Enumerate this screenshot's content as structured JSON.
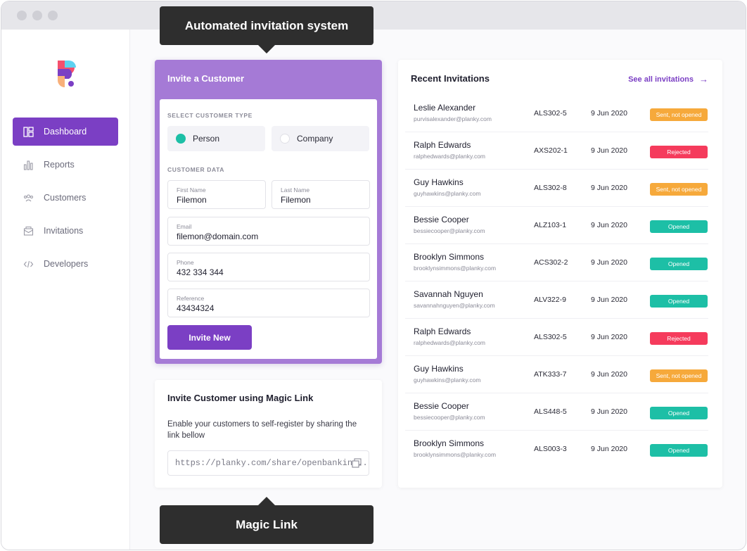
{
  "colors": {
    "accent": "#7b3fc4",
    "teal": "#1dbfa6",
    "orange": "#f6a93b",
    "red": "#f53b5c"
  },
  "sidebar": {
    "items": [
      {
        "label": "Dashboard",
        "icon": "dashboard-icon",
        "active": true
      },
      {
        "label": "Reports",
        "icon": "bar-chart-icon",
        "active": false
      },
      {
        "label": "Customers",
        "icon": "users-icon",
        "active": false
      },
      {
        "label": "Invitations",
        "icon": "envelope-icon",
        "active": false
      },
      {
        "label": "Developers",
        "icon": "code-icon",
        "active": false
      }
    ]
  },
  "callouts": {
    "top": "Automated invitation system",
    "bottom": "Magic Link"
  },
  "invite": {
    "title": "Invite a Customer",
    "type_label": "SELECT CUSTOMER TYPE",
    "type_person": "Person",
    "type_company": "Company",
    "selected_type": "Person",
    "data_label": "CUSTOMER DATA",
    "first_name_label": "First Name",
    "first_name_value": "Filemon",
    "last_name_label": "Last Name",
    "last_name_value": "Filemon",
    "email_label": "Email",
    "email_value": "filemon@domain.com",
    "phone_label": "Phone",
    "phone_value": "432 334 344",
    "reference_label": "Reference",
    "reference_value": "43434324",
    "button": "Invite New"
  },
  "magic": {
    "title": "Invite Customer using Magic Link",
    "description": "Enable your customers to self-register by sharing the link bellow",
    "link": "https://planky.com/share/openbankin..."
  },
  "recent": {
    "title": "Recent Invitations",
    "see_all": "See all invitations",
    "rows": [
      {
        "name": "Leslie Alexander",
        "email": "purvisalexander@planky.com",
        "code": "ALS302-5",
        "date": "9 Jun 2020",
        "status": "Sent, not opened",
        "color": "#f6a93b"
      },
      {
        "name": "Ralph Edwards",
        "email": "ralphedwards@planky.com",
        "code": "AXS202-1",
        "date": "9 Jun 2020",
        "status": "Rejected",
        "color": "#f53b5c"
      },
      {
        "name": "Guy Hawkins",
        "email": "guyhawkins@planky.com",
        "code": "ALS302-8",
        "date": "9 Jun 2020",
        "status": "Sent, not opened",
        "color": "#f6a93b"
      },
      {
        "name": "Bessie Cooper",
        "email": "bessiecooper@planky.com",
        "code": "ALZ103-1",
        "date": "9 Jun 2020",
        "status": "Opened",
        "color": "#1dbfa6"
      },
      {
        "name": "Brooklyn Simmons",
        "email": "brooklynsimmons@planky.com",
        "code": "ACS302-2",
        "date": "9 Jun 2020",
        "status": "Opened",
        "color": "#1dbfa6"
      },
      {
        "name": "Savannah Nguyen",
        "email": "savannahnguyen@planky.com",
        "code": "ALV322-9",
        "date": "9 Jun 2020",
        "status": "Opened",
        "color": "#1dbfa6"
      },
      {
        "name": "Ralph Edwards",
        "email": "ralphedwards@planky.com",
        "code": "ALS302-5",
        "date": "9 Jun 2020",
        "status": "Rejected",
        "color": "#f53b5c"
      },
      {
        "name": "Guy Hawkins",
        "email": "guyhawkins@planky.com",
        "code": "ATK333-7",
        "date": "9 Jun 2020",
        "status": "Sent, not opened",
        "color": "#f6a93b"
      },
      {
        "name": "Bessie Cooper",
        "email": "bessiecooper@planky.com",
        "code": "ALS448-5",
        "date": "9 Jun 2020",
        "status": "Opened",
        "color": "#1dbfa6"
      },
      {
        "name": "Brooklyn Simmons",
        "email": "brooklynsimmons@planky.com",
        "code": "ALS003-3",
        "date": "9 Jun 2020",
        "status": "Opened",
        "color": "#1dbfa6"
      }
    ]
  }
}
